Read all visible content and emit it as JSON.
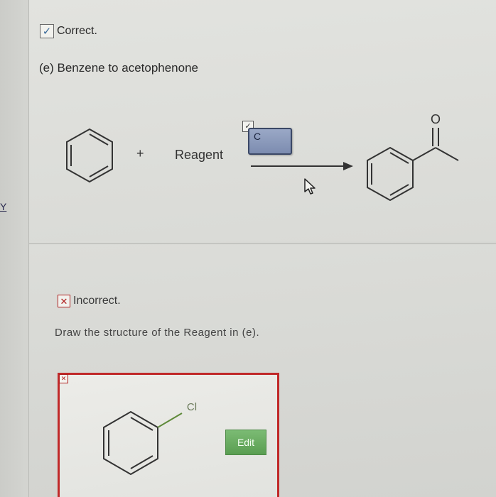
{
  "sidebar": {
    "fragment_text": "Y"
  },
  "correct_status": {
    "icon": "checkmark-icon",
    "icon_glyph": "✓",
    "text": "Correct."
  },
  "question": {
    "title": "(e) Benzene to acetophenone"
  },
  "reaction": {
    "reactant_structure": "benzene",
    "plus": "+",
    "reagent_label": "Reagent",
    "reagent_box_text": "C",
    "reagent_check_glyph": "✓",
    "product_structure": "acetophenone",
    "product_atom_label": "O"
  },
  "incorrect_status": {
    "icon": "x-mark-icon",
    "icon_glyph": "✕",
    "text": "Incorrect."
  },
  "prompt": {
    "text": "Draw the structure of the Reagent in (e)."
  },
  "answer": {
    "close_glyph": "✕",
    "structure": "chlorobenzene",
    "atom_label": "Cl",
    "edit_button_label": "Edit"
  },
  "colors": {
    "incorrect_border": "#c02828",
    "edit_button": "#5a9e52",
    "reagent_box": "#7c8cb0"
  }
}
